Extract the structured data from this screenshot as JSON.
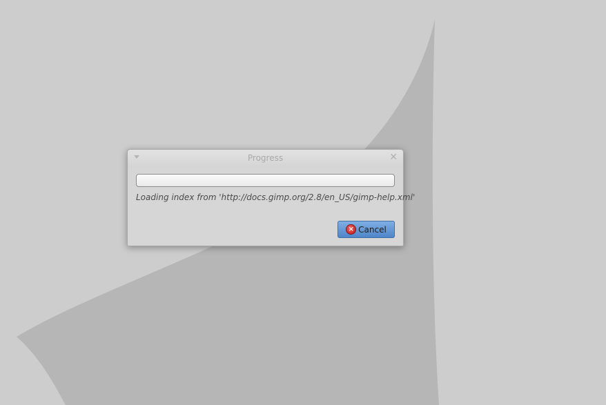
{
  "dialog": {
    "title": "Progress",
    "progress_fraction": 0,
    "status_text": "Loading index from 'http://docs.gimp.org/2.8/en_US/gimp-help.xml'",
    "cancel_label": "Cancel",
    "icons": {
      "menu": "window-menu-icon",
      "close": "close-icon",
      "cancel": "cancel-icon"
    }
  },
  "colors": {
    "desktop": "#cdcdcd",
    "wallpaper_shape": "#b6b6b6",
    "dialog_bg": "#d6d6d6",
    "button_accent": "#5b8fd0",
    "cancel_icon": "#d02828"
  }
}
